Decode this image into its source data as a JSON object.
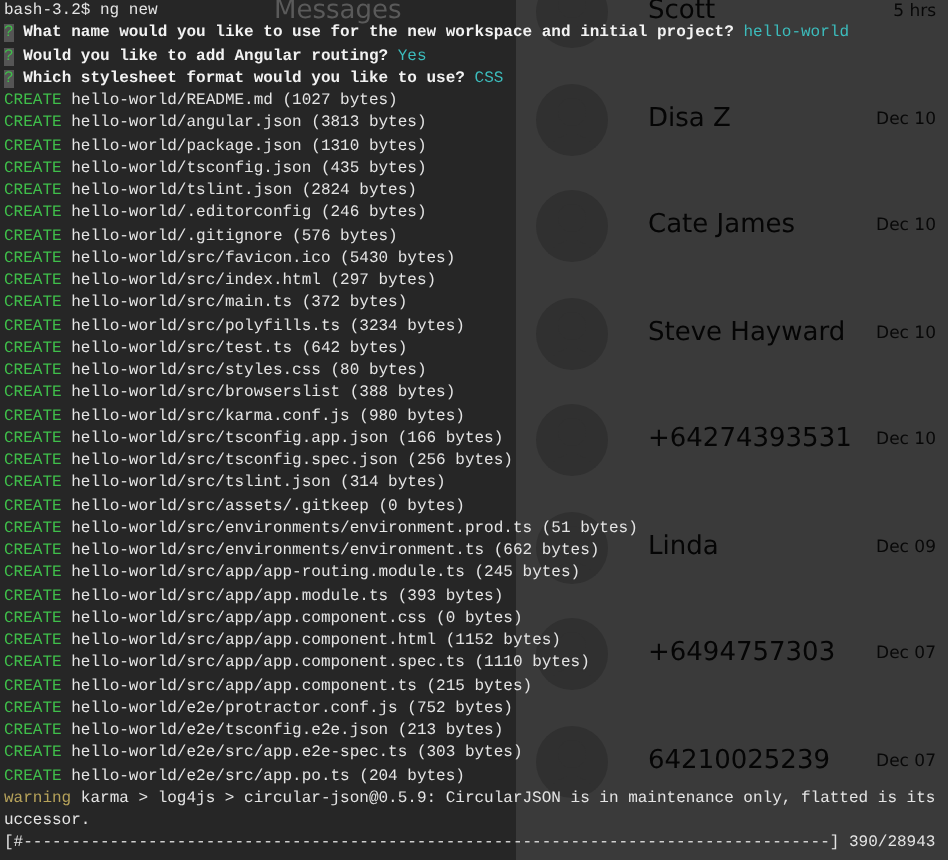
{
  "background_app": {
    "title": "Messages",
    "conversations": [
      {
        "name": "Scott",
        "time": "5 hrs"
      },
      {
        "name": "Disa Z",
        "time": "Dec 10"
      },
      {
        "name": "Cate James",
        "time": "Dec 10"
      },
      {
        "name": "Steve Hayward",
        "time": "Dec 10"
      },
      {
        "name": "+64274393531",
        "time": "Dec 10"
      },
      {
        "name": "Linda",
        "time": "Dec 09"
      },
      {
        "name": "+6494757303",
        "time": "Dec 07"
      },
      {
        "name": "64210025239",
        "time": "Dec 07"
      }
    ]
  },
  "terminal": {
    "lines": [
      {
        "kind": "prompt",
        "text": "bash-3.2$ ng new"
      },
      {
        "kind": "question",
        "mark": "?",
        "question": "What name would you like to use for the new workspace and initial project?",
        "answer": "hello-world"
      },
      {
        "kind": "question",
        "mark": "?",
        "question": "Would you like to add Angular routing?",
        "answer": "Yes"
      },
      {
        "kind": "question",
        "mark": "?",
        "question": "Which stylesheet format would you like to use?",
        "answer": "CSS"
      },
      {
        "kind": "create",
        "action": "CREATE",
        "text": "hello-world/README.md (1027 bytes)"
      },
      {
        "kind": "create",
        "action": "CREATE",
        "text": "hello-world/angular.json (3813 bytes)"
      },
      {
        "kind": "create",
        "action": "CREATE",
        "text": "hello-world/package.json (1310 bytes)"
      },
      {
        "kind": "create",
        "action": "CREATE",
        "text": "hello-world/tsconfig.json (435 bytes)"
      },
      {
        "kind": "create",
        "action": "CREATE",
        "text": "hello-world/tslint.json (2824 bytes)"
      },
      {
        "kind": "create",
        "action": "CREATE",
        "text": "hello-world/.editorconfig (246 bytes)"
      },
      {
        "kind": "create",
        "action": "CREATE",
        "text": "hello-world/.gitignore (576 bytes)"
      },
      {
        "kind": "create",
        "action": "CREATE",
        "text": "hello-world/src/favicon.ico (5430 bytes)"
      },
      {
        "kind": "create",
        "action": "CREATE",
        "text": "hello-world/src/index.html (297 bytes)"
      },
      {
        "kind": "create",
        "action": "CREATE",
        "text": "hello-world/src/main.ts (372 bytes)"
      },
      {
        "kind": "create",
        "action": "CREATE",
        "text": "hello-world/src/polyfills.ts (3234 bytes)"
      },
      {
        "kind": "create",
        "action": "CREATE",
        "text": "hello-world/src/test.ts (642 bytes)"
      },
      {
        "kind": "create",
        "action": "CREATE",
        "text": "hello-world/src/styles.css (80 bytes)"
      },
      {
        "kind": "create",
        "action": "CREATE",
        "text": "hello-world/src/browserslist (388 bytes)"
      },
      {
        "kind": "create",
        "action": "CREATE",
        "text": "hello-world/src/karma.conf.js (980 bytes)"
      },
      {
        "kind": "create",
        "action": "CREATE",
        "text": "hello-world/src/tsconfig.app.json (166 bytes)"
      },
      {
        "kind": "create",
        "action": "CREATE",
        "text": "hello-world/src/tsconfig.spec.json (256 bytes)"
      },
      {
        "kind": "create",
        "action": "CREATE",
        "text": "hello-world/src/tslint.json (314 bytes)"
      },
      {
        "kind": "create",
        "action": "CREATE",
        "text": "hello-world/src/assets/.gitkeep (0 bytes)"
      },
      {
        "kind": "create",
        "action": "CREATE",
        "text": "hello-world/src/environments/environment.prod.ts (51 bytes)"
      },
      {
        "kind": "create",
        "action": "CREATE",
        "text": "hello-world/src/environments/environment.ts (662 bytes)"
      },
      {
        "kind": "create",
        "action": "CREATE",
        "text": "hello-world/src/app/app-routing.module.ts (245 bytes)"
      },
      {
        "kind": "create",
        "action": "CREATE",
        "text": "hello-world/src/app/app.module.ts (393 bytes)"
      },
      {
        "kind": "create",
        "action": "CREATE",
        "text": "hello-world/src/app/app.component.css (0 bytes)"
      },
      {
        "kind": "create",
        "action": "CREATE",
        "text": "hello-world/src/app/app.component.html (1152 bytes)"
      },
      {
        "kind": "create",
        "action": "CREATE",
        "text": "hello-world/src/app/app.component.spec.ts (1110 bytes)"
      },
      {
        "kind": "create",
        "action": "CREATE",
        "text": "hello-world/src/app/app.component.ts (215 bytes)"
      },
      {
        "kind": "create",
        "action": "CREATE",
        "text": "hello-world/e2e/protractor.conf.js (752 bytes)"
      },
      {
        "kind": "create",
        "action": "CREATE",
        "text": "hello-world/e2e/tsconfig.e2e.json (213 bytes)"
      },
      {
        "kind": "create",
        "action": "CREATE",
        "text": "hello-world/e2e/src/app.e2e-spec.ts (303 bytes)"
      },
      {
        "kind": "create",
        "action": "CREATE",
        "text": "hello-world/e2e/src/app.po.ts (204 bytes)"
      },
      {
        "kind": "warning",
        "action": "warning",
        "text": "karma > log4js > circular-json@0.5.9: CircularJSON is in maintenance only, flatted is its"
      },
      {
        "kind": "plain",
        "text": "uccessor."
      },
      {
        "kind": "progress",
        "text": "[#------------------------------------------------------------------------------------]",
        "count": "390/28943"
      }
    ]
  }
}
